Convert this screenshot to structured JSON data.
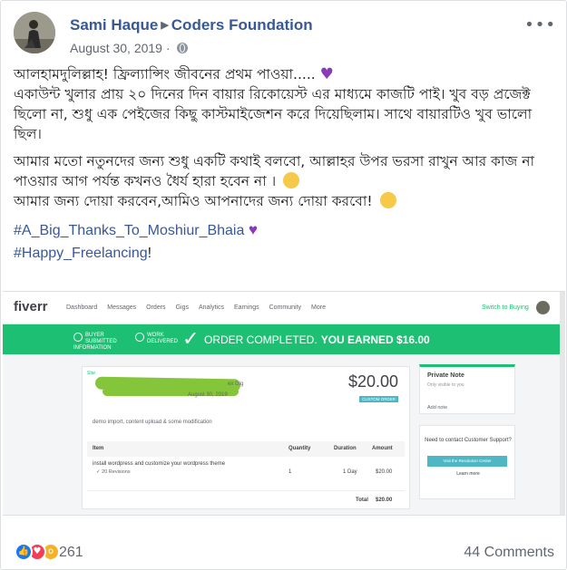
{
  "post": {
    "author": "Sami Haque",
    "group": "Coders Foundation",
    "date": "August 30, 2019",
    "separator": "·",
    "more_icon": "ellipsis-icon",
    "paragraphs": [
      "আলহামদুলিল্লাহ! ফ্রিল্যান্সিং জীবনের প্রথম পাওয়া..... ",
      "একাউন্ট খুলার প্রায় ২০ দিনের দিন বায়ার রিকোয়েস্ট এর মাধ্যমে কাজটি পাই। খুব বড় প্রজেক্ট ছিলো না, শুধু এক পেইজের কিছু কাস্টমাইজেশন করে দিয়েছিলাম। সাথে বায়ারটিও খুব ভালো ছিল।",
      "আমার মতো নতুনদের জন্য শুধু একটি কথাই বলবো, আল্লাহর উপর ভরসা রাখুন আর কাজ না পাওয়ার আগ পর্যন্ত কখনও ধৈর্য হারা হবেন না । ",
      "আমার জন্য দোয়া করবেন,আমিও আপনাদের জন্য দোয়া করবো! "
    ],
    "hashtags": [
      "#A_Big_Thanks_To_Moshiur_Bhaia",
      "#Happy_Freelancing"
    ],
    "hashtag_suffix": "!",
    "reaction_count": "261",
    "comments_label": "44 Comments"
  },
  "screenshot": {
    "logo": "fiverr",
    "nav": [
      "Dashboard",
      "Messages",
      "Orders",
      "Gigs",
      "Analytics",
      "Earnings",
      "Community",
      "More"
    ],
    "switch_label": "Switch to Buying",
    "steps": [
      "BUYER SUBMITTED INFORMATION",
      "WORK DELIVERED"
    ],
    "banner_text": "ORDER COMPLETED.",
    "banner_earned": "YOU EARNED $16.00",
    "star_label": "Star",
    "gig_suffix": "ex Gig",
    "order_date": "August 30, 2019",
    "price": "$20.00",
    "custom_badge": "CUSTOM ORDER",
    "description": "demo import, content upload & some modification",
    "table_headers": [
      "Item",
      "Quantity",
      "Duration",
      "Amount"
    ],
    "row_item": "install wordpress and customize your wordpress theme",
    "row_revisions": "✓ 20 Revisions",
    "row_qty": "1",
    "row_duration": "1 Day",
    "row_amount": "$20.00",
    "total_label": "Total",
    "total_value": "$20.00",
    "note_title": "Private Note",
    "note_sub": "Only visible to you",
    "note_add": "Add note",
    "help_text": "Need to contact Customer Support?",
    "help_button": "Visit the Resolution Center",
    "learn_more": "Learn more"
  },
  "colors": {
    "link": "#385898",
    "fiverr_green": "#1dbf73",
    "like": "#1877f2",
    "love": "#f33e58"
  }
}
